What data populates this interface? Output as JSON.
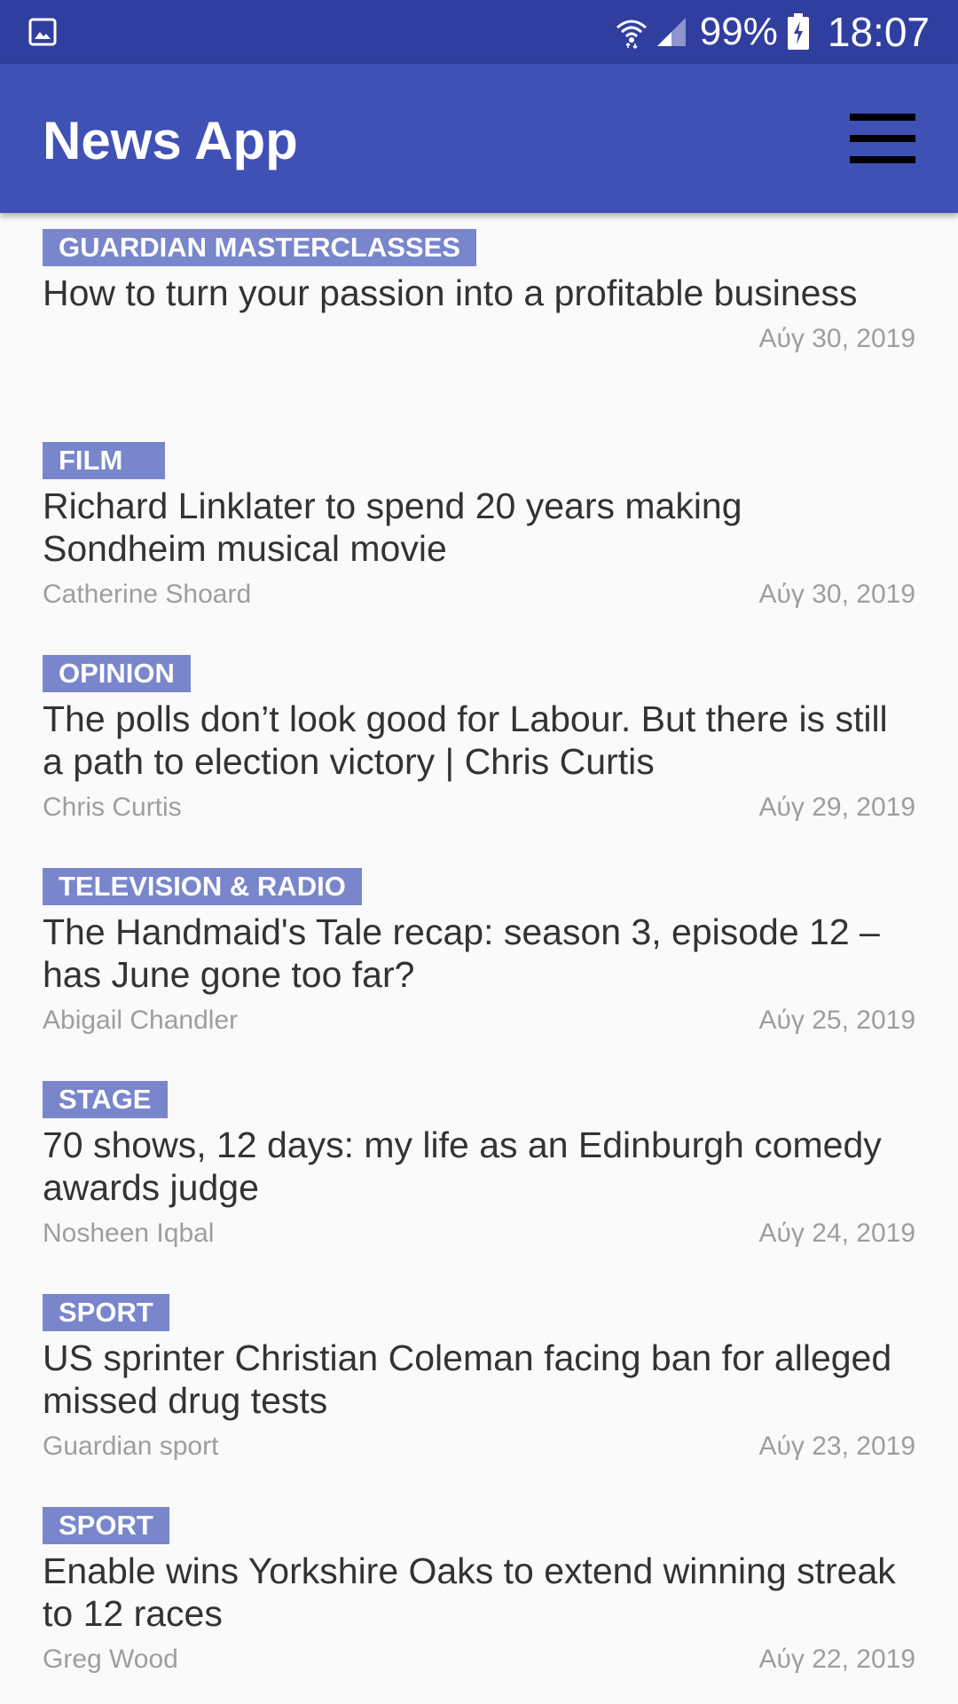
{
  "status_bar": {
    "battery_percent": "99%",
    "time": "18:07",
    "icons": [
      "gallery-icon",
      "wifi-icon",
      "signal-icon",
      "battery-icon"
    ]
  },
  "app_bar": {
    "title": "News App",
    "menu_icon": "hamburger-menu-icon"
  },
  "colors": {
    "status_bar": "#303f9f",
    "app_bar": "#3f51b5",
    "section_tag": "#7986cb",
    "headline_text": "#333333",
    "meta_text": "#9e9e9e",
    "background": "#fafafa"
  },
  "articles": [
    {
      "section": "Guardian Masterclasses",
      "headline": "How to turn your passion into a profitable business",
      "author": "",
      "date": "Αύγ 30, 2019"
    },
    {
      "section": "Film",
      "headline": "Richard Linklater to spend 20 years making Sondheim musical movie",
      "author": "Catherine Shoard",
      "date": "Αύγ 30, 2019"
    },
    {
      "section": "Opinion",
      "headline": "The polls don’t look good for Labour. But there is still a path to election victory | Chris Curtis",
      "author": "Chris Curtis",
      "date": "Αύγ 29, 2019"
    },
    {
      "section": "Television & radio",
      "headline": "The Handmaid's Tale recap: season 3, episode 12 – has June gone too far?",
      "author": "Abigail Chandler",
      "date": "Αύγ 25, 2019"
    },
    {
      "section": "Stage",
      "headline": "70 shows, 12 days: my life as an Edinburgh comedy awards judge",
      "author": "Nosheen Iqbal",
      "date": "Αύγ 24, 2019"
    },
    {
      "section": "Sport",
      "headline": "US sprinter Christian Coleman facing ban for alleged missed drug tests",
      "author": "Guardian sport",
      "date": "Αύγ 23, 2019"
    },
    {
      "section": "Sport",
      "headline": "Enable wins Yorkshire Oaks to extend winning streak to 12 races",
      "author": "Greg Wood",
      "date": "Αύγ 22, 2019"
    }
  ]
}
